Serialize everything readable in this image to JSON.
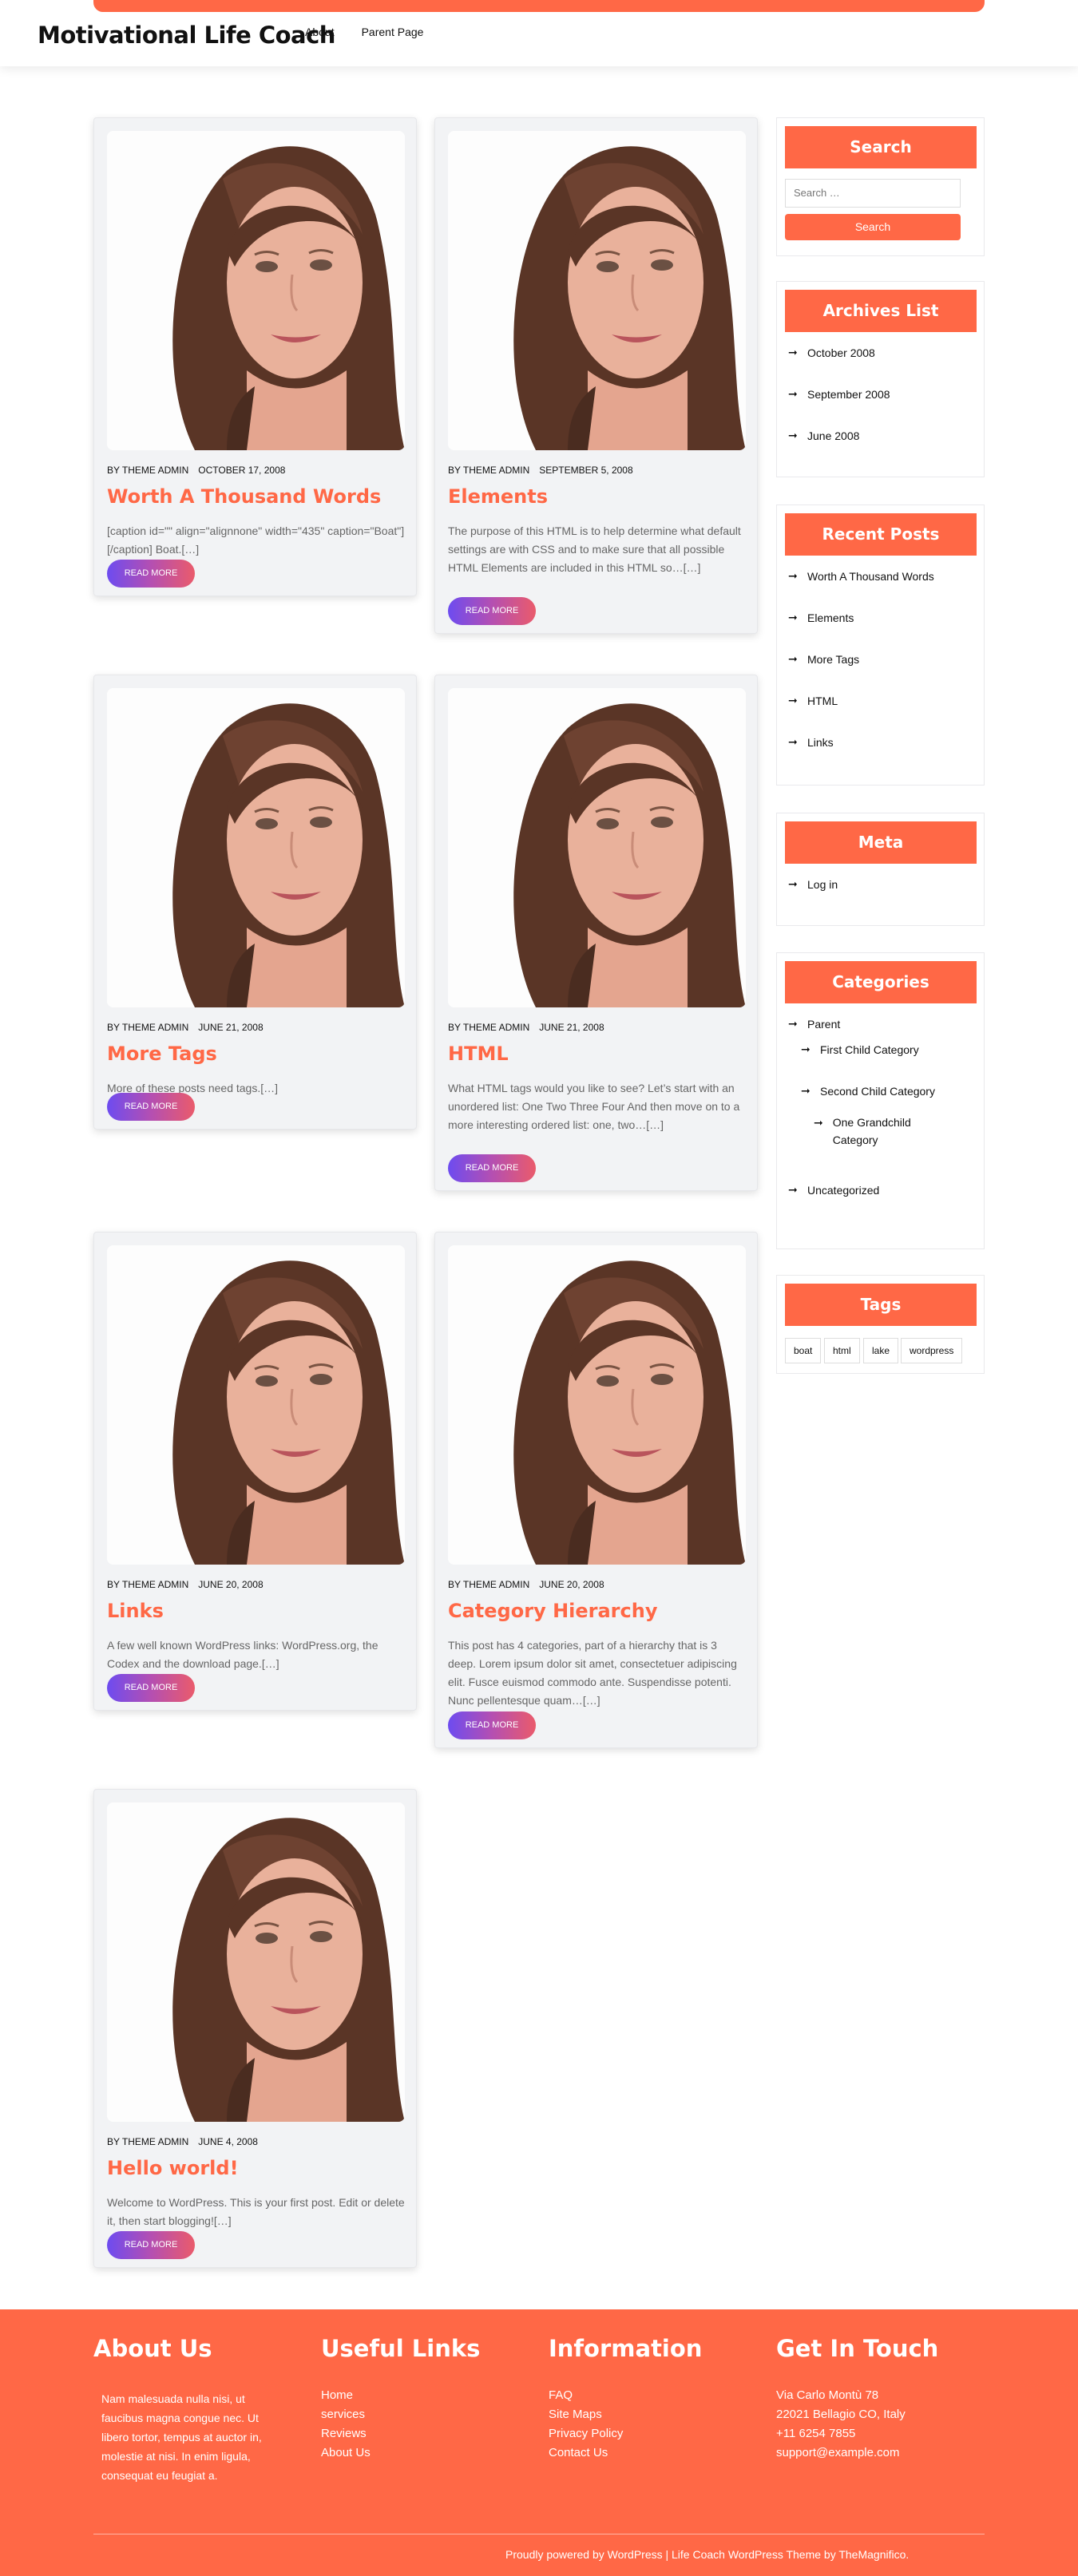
{
  "site": {
    "title": "Motivational Life Coach"
  },
  "nav": [
    {
      "label": "About"
    },
    {
      "label": "Parent Page"
    }
  ],
  "posts": [
    {
      "author": "BY THEME ADMIN",
      "date": "OCTOBER 17, 2008",
      "title": "Worth A Thousand Words",
      "excerpt": "[caption id=\"\" align=\"alignnone\" width=\"435\" caption=\"Boat\"][/caption] Boat.[…]",
      "button": "READ MORE"
    },
    {
      "author": "BY THEME ADMIN",
      "date": "SEPTEMBER 5, 2008",
      "title": "Elements",
      "excerpt": "The purpose of this HTML is to help determine what default settings are with CSS and to make sure that all possible HTML Elements are included in this HTML so…[…]",
      "button": "READ MORE"
    },
    {
      "author": "BY THEME ADMIN",
      "date": "JUNE 21, 2008",
      "title": "More Tags",
      "excerpt": "More of these posts need tags.[…]",
      "button": "READ MORE"
    },
    {
      "author": "BY THEME ADMIN",
      "date": "JUNE 21, 2008",
      "title": "HTML",
      "excerpt": "What HTML tags would you like to see? Let’s start with an unordered list: One Two Three Four And then move on to a more interesting ordered list: one, two…[…]",
      "button": "READ MORE"
    },
    {
      "author": "BY THEME ADMIN",
      "date": "JUNE 20, 2008",
      "title": "Links",
      "excerpt": "A few well known WordPress links: WordPress.org, the Codex and the download page.[…]",
      "button": "READ MORE"
    },
    {
      "author": "BY THEME ADMIN",
      "date": "JUNE 20, 2008",
      "title": "Category Hierarchy",
      "excerpt": "This post has 4 categories, part of a hierarchy that is 3 deep. Lorem ipsum dolor sit amet, consectetuer adipiscing elit. Fusce euismod commodo ante. Suspendisse potenti. Nunc pellentesque quam…[…]",
      "button": "READ MORE"
    },
    {
      "author": "BY THEME ADMIN",
      "date": "JUNE 4, 2008",
      "title": "Hello world!",
      "excerpt": "Welcome to WordPress. This is your first post. Edit or delete it, then start blogging![…]",
      "button": "READ MORE"
    }
  ],
  "sidebar": {
    "search": {
      "title": "Search",
      "placeholder": "Search …",
      "button": "Search"
    },
    "archives": {
      "title": "Archives List",
      "items": [
        "October 2008",
        "September 2008",
        "June 2008"
      ]
    },
    "recent": {
      "title": "Recent Posts",
      "items": [
        "Worth A Thousand Words",
        "Elements",
        "More Tags",
        "HTML",
        "Links"
      ]
    },
    "meta": {
      "title": "Meta",
      "items": [
        "Log in"
      ]
    },
    "categories": {
      "title": "Categories",
      "items": [
        "Parent",
        "First Child Category",
        "Second Child Category",
        "One Grandchild Category",
        "Uncategorized"
      ]
    },
    "tags": {
      "title": "Tags",
      "items": [
        "boat",
        "html",
        "lake",
        "wordpress"
      ]
    }
  },
  "footer": {
    "about": {
      "title": "About Us",
      "text": "Nam malesuada nulla nisi, ut faucibus magna congue nec. Ut libero tortor, tempus at auctor in, molestie at nisi. In enim ligula, consequat eu feugiat a."
    },
    "links": {
      "title": "Useful Links",
      "items": [
        "Home",
        "services",
        "Reviews",
        "About Us"
      ]
    },
    "info": {
      "title": "Information",
      "items": [
        "FAQ",
        "Site Maps",
        "Privacy Policy",
        "Contact Us"
      ]
    },
    "contact": {
      "title": "Get In Touch",
      "items": [
        "Via Carlo Montù 78",
        "22021 Bellagio CO, Italy",
        "+11 6254 7855",
        "support@example.com"
      ]
    },
    "copyright": "Proudly powered by WordPress |  Life Coach WordPress Theme by TheMagnifico."
  }
}
